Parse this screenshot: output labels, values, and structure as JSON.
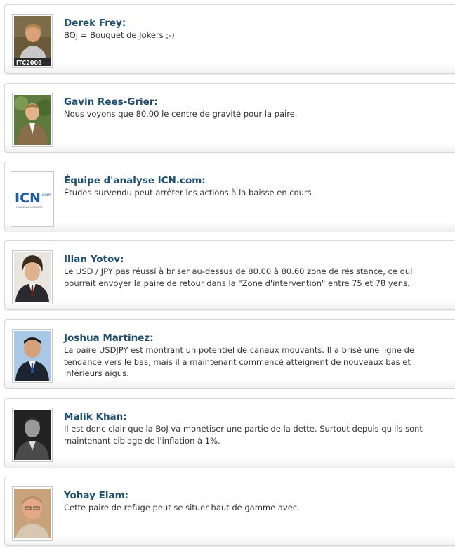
{
  "comments": [
    {
      "author": "Derek Frey:",
      "text": "BOJ = Bouquet de Jokers ;-)",
      "avatar_icon": "person-photo-icon",
      "avatar_badge": "ITC2008"
    },
    {
      "author": "Gavin Rees-Grier:",
      "text": "Nous voyons que 80,00 le centre de gravité pour la paire.",
      "avatar_icon": "person-photo-icon"
    },
    {
      "author": "Équipe d'analyse ICN.com:",
      "text": "Études survendu peut arrêter les actions à la baisse en cours",
      "avatar_icon": "icn-logo-icon",
      "avatar_logo": {
        "main": "ICN",
        "suffix": ".com",
        "tagline": "FINANCIAL MARKETS"
      }
    },
    {
      "author": "Ilian Yotov:",
      "text": "Le USD / JPY pas réussi à briser au-dessus de 80.00 à 80.60 zone de résistance, ce qui pourrait envoyer la paire de retour dans la \"Zone d'intervention\" entre 75 et 78 yens.",
      "avatar_icon": "person-photo-icon"
    },
    {
      "author": "Joshua Martinez:",
      "text": "La paire USDJPY est montrant un potentiel de canaux mouvants. Il a brisé une ligne de tendance vers le bas, mais il a maintenant commencé atteignent de nouveaux bas et inférieurs aigus.",
      "avatar_icon": "person-photo-icon"
    },
    {
      "author": "Malik Khan:",
      "text": "Il est donc clair que la BoJ va monétiser une partie de la dette. Surtout depuis qu'ils sont maintenant ciblage de l'inflation à 1%.",
      "avatar_icon": "person-photo-icon"
    },
    {
      "author": "Yohay Elam:",
      "text": "Cette paire de refuge peut se situer haut de gamme avec.",
      "avatar_icon": "person-photo-icon"
    }
  ],
  "colors": {
    "author_name": "#1f4e6e",
    "comment_text": "#333333",
    "card_border": "#d6d6d6",
    "icn_blue": "#1c5da8"
  }
}
